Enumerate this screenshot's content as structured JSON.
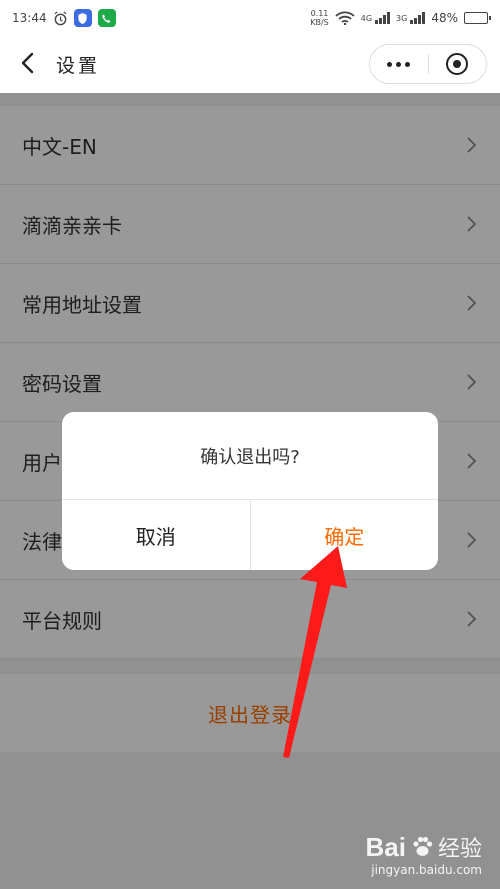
{
  "status_bar": {
    "time": "13:44",
    "net_speed_value": "0.11",
    "net_speed_unit": "KB/S",
    "signal1": "4G",
    "signal2": "3G",
    "battery": "48%",
    "battery_level": 0.48
  },
  "header": {
    "title": "设置",
    "back_icon": "chevron-left-icon",
    "more_icon": "ellipsis-icon",
    "close_icon": "target-circle-icon"
  },
  "settings": {
    "items": [
      {
        "label": "中文-EN"
      },
      {
        "label": "滴滴亲亲卡"
      },
      {
        "label": "常用地址设置"
      },
      {
        "label": "密码设置"
      },
      {
        "label": "用户指南"
      },
      {
        "label": "法律条款"
      },
      {
        "label": "平台规则"
      }
    ]
  },
  "logout": {
    "label": "退出登录"
  },
  "dialog": {
    "message": "确认退出吗?",
    "cancel": "取消",
    "confirm": "确定"
  },
  "watermark": {
    "brand": "Bai",
    "brand_suffix": "经验",
    "url": "jingyan.baidu.com"
  },
  "colors": {
    "accent": "#ff6a00",
    "arrow": "#ff1a1a",
    "overlay": "rgba(0,0,0,0.4)"
  }
}
